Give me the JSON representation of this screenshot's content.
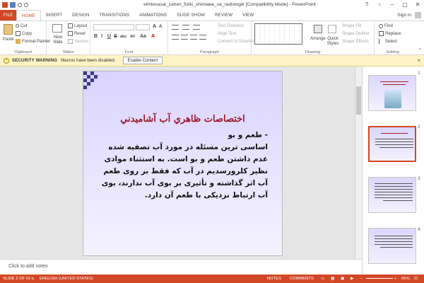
{
  "window": {
    "title": "ekhtesasat_zaheri_fiziki_shimiaee_va_radiologik [Compatibility Mode] - PowerPoint",
    "controls": [
      "?",
      "▫",
      "–",
      "▢",
      "✕"
    ]
  },
  "tabs": {
    "items": [
      "FILE",
      "HOME",
      "INSERT",
      "DESIGN",
      "TRANSITIONS",
      "ANIMATIONS",
      "SLIDE SHOW",
      "REVIEW",
      "VIEW"
    ],
    "active": "HOME",
    "sign_in": "Sign in"
  },
  "ribbon": {
    "clipboard": {
      "paste": "Paste",
      "cut": "Cut",
      "copy": "Copy",
      "format_painter": "Format Painter",
      "label": "Clipboard"
    },
    "slides": {
      "new_slide": "New Slide",
      "layout": "Layout",
      "reset": "Reset",
      "section": "Section",
      "label": "Slides"
    },
    "font": {
      "label": "Font",
      "bold": "B",
      "italic": "I",
      "underline": "U",
      "strike": "S",
      "shadow": "abc",
      "spacing": "AV",
      "case": "Aa",
      "color": "A"
    },
    "paragraph": {
      "label": "Paragraph",
      "text_direction": "Text Direction",
      "align_text": "Align Text",
      "convert_smartart": "Convert to SmartArt"
    },
    "drawing": {
      "label": "Drawing",
      "arrange": "Arrange",
      "quick_styles": "Quick Styles",
      "shape_fill": "Shape Fill",
      "shape_outline": "Shape Outline",
      "shape_effects": "Shape Effects"
    },
    "editing": {
      "label": "Editing",
      "find": "Find",
      "replace": "Replace",
      "select": "Select"
    }
  },
  "security_bar": {
    "title": "SECURITY WARNING",
    "message": "Macros have been disabled.",
    "button": "Enable Content"
  },
  "slide": {
    "title": "اختصاصات ظاهري آب آشاميدني",
    "subhead": "- طعم و بو",
    "body": "اساسی ترین مسئله در مورد آب تصفیه شده عدم داشتن طعم و بو است. به استثناء موادی نظیر کلرورسدیم در آب که فقط بر روی طعم آب اثر گذاشته و تأثیری بر بوی آب ندارند، بوی آب ارتباط نزدیکی با طعم آن دارد."
  },
  "notes_placeholder": "Click to add notes",
  "thumbnails": [
    "1",
    "2",
    "3",
    "4"
  ],
  "status": {
    "slide_position": "SLIDE 2 OF 61",
    "language": "ENGLISH (UNITED STATES)",
    "notes": "NOTES",
    "comments": "COMMENTS",
    "zoom": "66%"
  },
  "colors": {
    "accent": "#d24726",
    "slide_title": "#9b1a2b",
    "warning_bar": "#fff4c6"
  }
}
